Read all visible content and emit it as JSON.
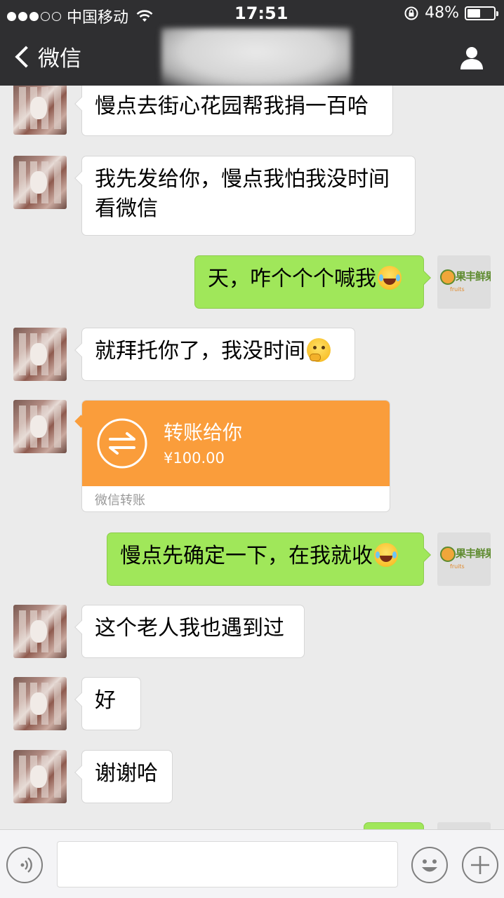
{
  "status_bar": {
    "carrier": "中国移动",
    "time": "17:51",
    "battery": "48%",
    "battery_level": 0.48,
    "signal_bars": 3
  },
  "nav": {
    "back_label": "微信",
    "title_blurred": true,
    "contact_icon": "person-icon"
  },
  "colors": {
    "nav_bg": "#2f2f31",
    "chat_bg": "#ebebeb",
    "bubble_out": "#a0e75a",
    "transfer_orange": "#fa9d3b"
  },
  "messages": [
    {
      "side": "left",
      "text": "慢点去街心花园帮我捐一百哈"
    },
    {
      "side": "left",
      "lines": [
        "我先发给你，慢点我怕我没时间",
        "看微信"
      ]
    },
    {
      "side": "right",
      "text": "天，咋个个个喊我",
      "emoji": "tears-of-joy"
    },
    {
      "side": "left",
      "text": "就拜托你了，我没时间",
      "emoji": "thinking"
    },
    {
      "side": "left",
      "type": "transfer",
      "title": "转账给你",
      "amount": "¥100.00",
      "footer": "微信转账"
    },
    {
      "side": "right",
      "text": "慢点先确定一下，在我就收",
      "emoji": "tears-of-joy"
    },
    {
      "side": "left",
      "text": "这个老人我也遇到过"
    },
    {
      "side": "left",
      "text": "好"
    },
    {
      "side": "left",
      "text": "谢谢哈"
    }
  ],
  "input_bar": {
    "voice_icon": "voice-icon",
    "emoji_icon": "emoji-icon",
    "plus_icon": "plus-icon",
    "draft": ""
  }
}
